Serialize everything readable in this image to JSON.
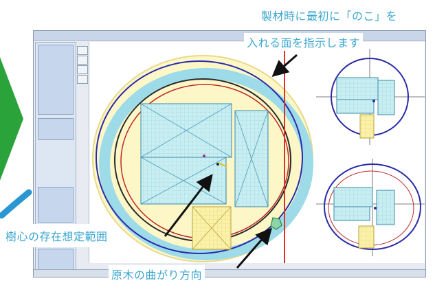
{
  "annotations": {
    "top_line1": "製材時に最初に「のこ」を",
    "top_line2": "入れる面を指示します",
    "pith_range": "樹心の存在想定範囲",
    "log_bend": "原木の曲がり方向"
  },
  "colors": {
    "annotation_text": "#3aa6cf",
    "chevron": "#2aa43a",
    "board_fill": "#bfe6ec",
    "accent_red": "#e0302a",
    "outline_blue": "#2a2aa8"
  },
  "icons": [
    "arrow-icon",
    "chevron-right-icon"
  ]
}
